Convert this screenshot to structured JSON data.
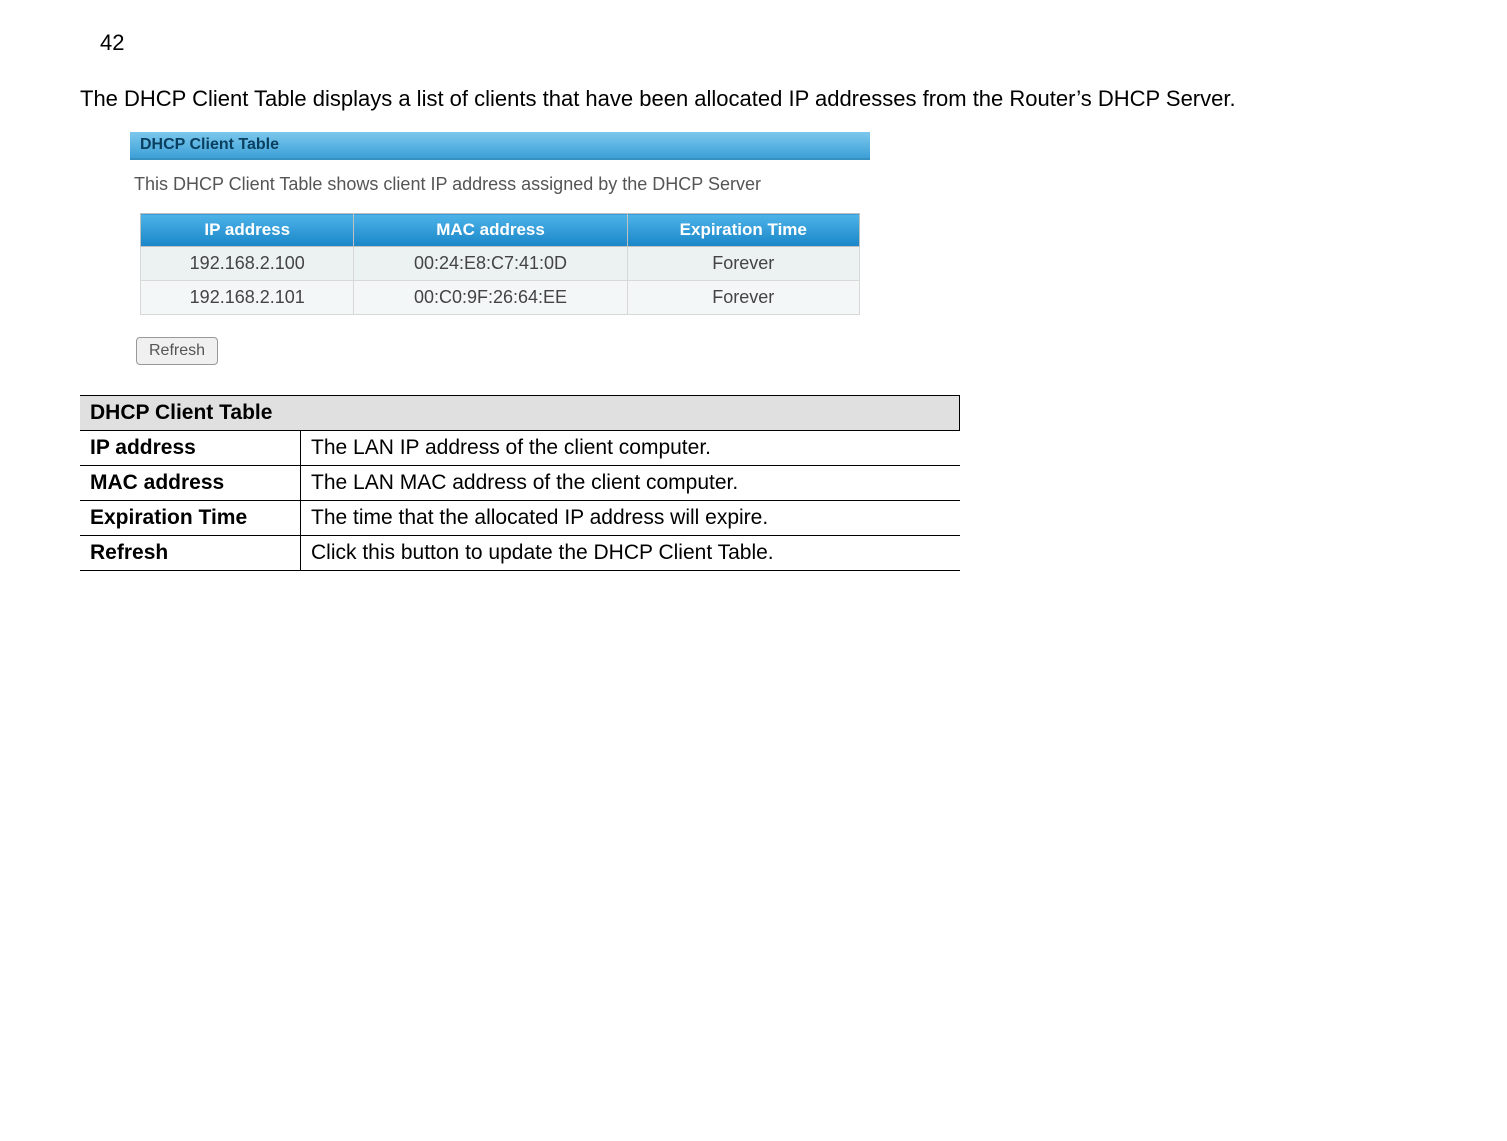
{
  "page_number": "42",
  "intro": "The DHCP Client Table displays a list of clients that have been allocated IP addresses from the Router’s DHCP Server.",
  "dhcp": {
    "header": "DHCP Client Table",
    "description": "This DHCP Client Table shows client IP address assigned by the DHCP Server",
    "columns": {
      "ip": "IP address",
      "mac": "MAC address",
      "exp": "Expiration Time"
    },
    "rows": [
      {
        "ip": "192.168.2.100",
        "mac": "00:24:E8:C7:41:0D",
        "exp": "Forever"
      },
      {
        "ip": "192.168.2.101",
        "mac": "00:C0:9F:26:64:EE",
        "exp": "Forever"
      }
    ],
    "refresh_label": "Refresh"
  },
  "def": {
    "title": "DHCP Client Table",
    "rows": [
      {
        "term": "IP address",
        "desc": "The LAN IP address of the client computer."
      },
      {
        "term": "MAC address",
        "desc": "The LAN MAC address of the client computer."
      },
      {
        "term": "Expiration Time",
        "desc": "The time that the allocated IP address will expire."
      },
      {
        "term": "Refresh",
        "desc": "Click this button to update the DHCP Client Table."
      }
    ]
  }
}
